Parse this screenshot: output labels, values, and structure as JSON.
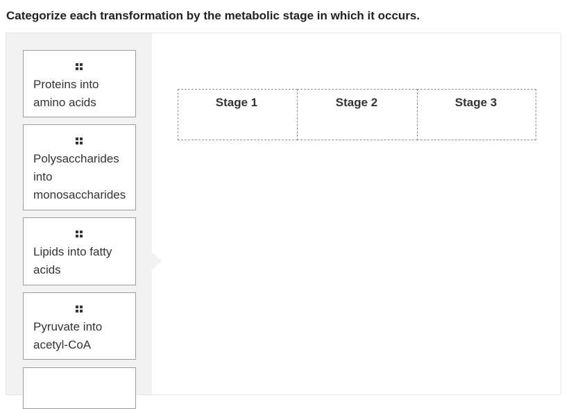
{
  "question": "Categorize each transformation by the metabolic stage in which it occurs.",
  "bank": {
    "cards": [
      {
        "label": "Proteins into amino acids"
      },
      {
        "label": "Polysaccharides into monosaccharides"
      },
      {
        "label": "Lipids into fatty acids"
      },
      {
        "label": "Pyruvate into acetyl-CoA"
      },
      {
        "label": ""
      }
    ]
  },
  "columns": [
    {
      "header": "Stage 1"
    },
    {
      "header": "Stage 2"
    },
    {
      "header": "Stage 3"
    }
  ],
  "icons": {
    "drag_handle": "grip-icon"
  }
}
